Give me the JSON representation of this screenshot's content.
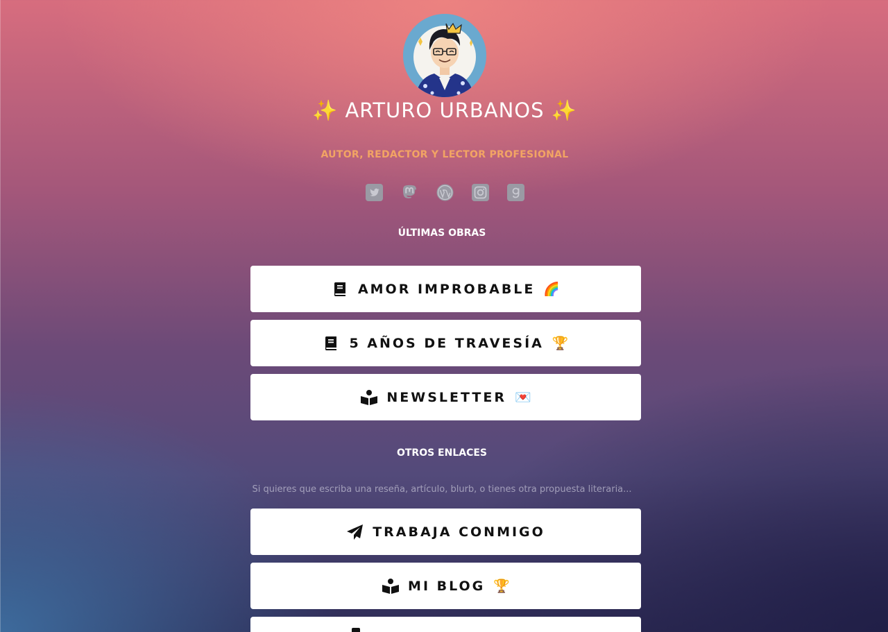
{
  "profile": {
    "name": "✨ ARTURO URBANOS ✨",
    "subtitle": "AUTOR, REDACTOR Y LECTOR PROFESIONAL"
  },
  "socials": [
    {
      "icon": "twitter-icon"
    },
    {
      "icon": "mastodon-icon"
    },
    {
      "icon": "wordpress-icon"
    },
    {
      "icon": "instagram-icon"
    },
    {
      "icon": "goodreads-icon"
    }
  ],
  "sections": {
    "latest": "ÚLTIMAS OBRAS",
    "other": "OTROS ENLACES",
    "other_hint": "Si quieres que escriba una reseña, artículo, blurb, o tienes otra propuesta literaria..."
  },
  "buttons": {
    "amor": {
      "label": "AMOR IMPROBABLE",
      "emoji": "🌈",
      "icon": "book-icon"
    },
    "travesia": {
      "label": "5 AÑOS DE TRAVESÍA",
      "emoji": "🏆",
      "icon": "book-icon"
    },
    "newsletter": {
      "label": "NEWSLETTER",
      "emoji": "💌",
      "icon": "reader-icon"
    },
    "trabaja": {
      "label": "TRABAJA CONMIGO",
      "icon": "paper-plane-icon"
    },
    "blog": {
      "label": "MI BLOG",
      "emoji": "🏆",
      "icon": "reader-icon"
    }
  },
  "colors": {
    "accent": "#f2a464",
    "button_bg": "#ffffff",
    "social_icon": "#9a9aa4"
  }
}
